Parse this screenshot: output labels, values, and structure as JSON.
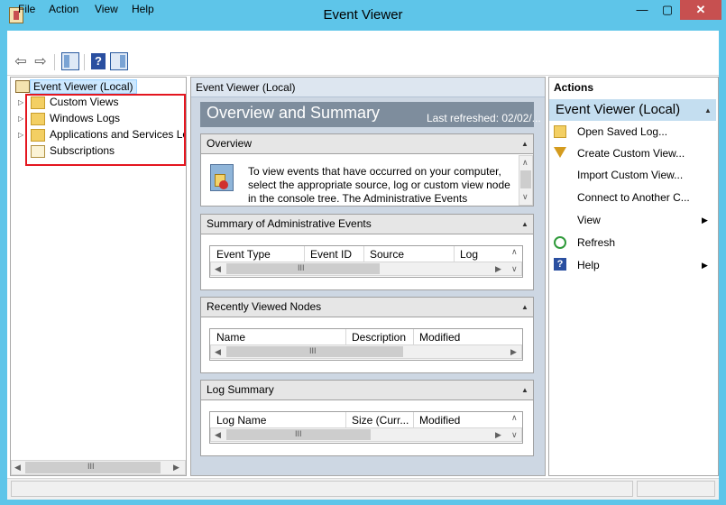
{
  "window": {
    "title": "Event Viewer",
    "buttons": {
      "minimize": "—",
      "maximize": "▢",
      "close": "✕"
    }
  },
  "menu": [
    "File",
    "Action",
    "View",
    "Help"
  ],
  "toolbar": {
    "back_icon": "back-arrow-icon",
    "forward_icon": "forward-arrow-icon",
    "help_glyph": "?"
  },
  "tree": {
    "root": "Event Viewer (Local)",
    "items": [
      {
        "label": "Custom Views",
        "icon": "folder-icon"
      },
      {
        "label": "Windows Logs",
        "icon": "folder-icon"
      },
      {
        "label": "Applications and Services Lo",
        "icon": "folder-icon"
      },
      {
        "label": "Subscriptions",
        "icon": "subscriptions-icon"
      }
    ],
    "scroll_thumb_glyph": "III"
  },
  "middle": {
    "header": "Event Viewer (Local)",
    "banner_title": "Overview and Summary",
    "banner_refresh": "Last refreshed: 02/02/...",
    "overview": {
      "title": "Overview",
      "text": "To view events that have occurred on your computer, select the appropriate source, log or custom view node in the console tree. The Administrative Events"
    },
    "admin_events": {
      "title": "Summary of Administrative Events",
      "columns": [
        "Event Type",
        "Event ID",
        "Source",
        "Log"
      ]
    },
    "recent_nodes": {
      "title": "Recently Viewed Nodes",
      "columns": [
        "Name",
        "Description",
        "Modified"
      ]
    },
    "log_summary": {
      "title": "Log Summary",
      "columns": [
        "Log Name",
        "Size (Curr...",
        "Modified"
      ]
    },
    "scroll_thumb_glyph": "III"
  },
  "actions": {
    "title": "Actions",
    "group": "Event Viewer (Local)",
    "items": [
      {
        "label": "Open Saved Log...",
        "icon": "open-log-icon"
      },
      {
        "label": "Create Custom View...",
        "icon": "filter-icon"
      },
      {
        "label": "Import Custom View...",
        "icon": ""
      },
      {
        "label": "Connect to Another C...",
        "icon": ""
      },
      {
        "label": "View",
        "icon": "",
        "submenu": true
      },
      {
        "label": "Refresh",
        "icon": "refresh-icon"
      },
      {
        "label": "Help",
        "icon": "help-icon",
        "submenu": true
      }
    ]
  },
  "colors": {
    "title_bar": "#5ec5e9",
    "close_button": "#c75050",
    "selection": "#cce8ff",
    "highlight_box": "#e4161f",
    "banner": "#7e8d9d"
  }
}
